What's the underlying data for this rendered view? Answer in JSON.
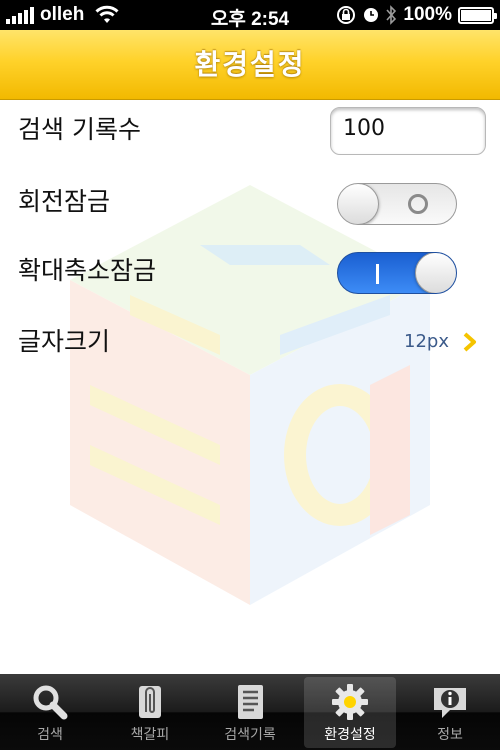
{
  "status_bar": {
    "carrier": "olleh",
    "time": "오후 2:54",
    "battery": "100%",
    "battery_level": 1.0
  },
  "title": "환경설정",
  "settings": {
    "search_history": {
      "label": "검색 기록수",
      "value": "100"
    },
    "rotation_lock": {
      "label": "회전잠금",
      "on": false
    },
    "zoom_lock": {
      "label": "확대축소잠금",
      "on": true
    },
    "font_size": {
      "label": "글자크기",
      "value": "12px"
    }
  },
  "tabs": [
    {
      "label": "검색",
      "icon": "search-icon",
      "active": false
    },
    {
      "label": "책갈피",
      "icon": "paperclip-icon",
      "active": false
    },
    {
      "label": "검색기록",
      "icon": "notebook-icon",
      "active": false
    },
    {
      "label": "환경설정",
      "icon": "gear-icon",
      "active": true
    },
    {
      "label": "정보",
      "icon": "info-icon",
      "active": false
    }
  ],
  "colors": {
    "title_bar": "#ffd22a",
    "toggle_on": "#2a78e8",
    "value_text": "#3b5a8a",
    "chevron": "#f5c400",
    "active_tab_icon_dot": "#ffd400"
  }
}
